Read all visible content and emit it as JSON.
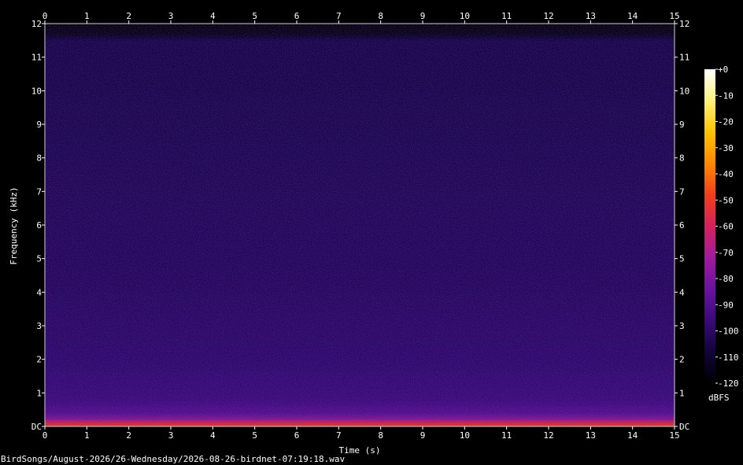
{
  "chart_data": {
    "type": "heatmap",
    "subtype": "spectrogram",
    "xlabel": "Time (s)",
    "ylabel": "Frequency (kHz)",
    "x_ticks": [
      "0",
      "1",
      "2",
      "3",
      "4",
      "5",
      "6",
      "7",
      "8",
      "9",
      "10",
      "11",
      "12",
      "13",
      "14",
      "15"
    ],
    "y_ticks": [
      "DC",
      "1",
      "2",
      "3",
      "4",
      "5",
      "6",
      "7",
      "8",
      "9",
      "10",
      "11",
      "12"
    ],
    "xlim": [
      0,
      15
    ],
    "ylim": [
      0,
      12
    ],
    "colorbar": {
      "label": "dBFS",
      "ticks": [
        "+0",
        "-10",
        "-20",
        "-30",
        "-40",
        "-50",
        "-60",
        "-70",
        "-80",
        "-90",
        "-100",
        "-110",
        "-120"
      ],
      "range": [
        -120,
        0
      ],
      "colormap": [
        "#000000",
        "#12043a",
        "#3a0a7a",
        "#6a12a0",
        "#a11a9c",
        "#d2225e",
        "#f0401a",
        "#ff8800",
        "#ffc400",
        "#fff27a",
        "#ffffff"
      ]
    },
    "energy_profile": {
      "description_free": true,
      "frequency_khz": [
        0,
        0.1,
        0.2,
        0.4,
        0.7,
        1.0,
        2.0,
        4.0,
        8.0,
        11.5,
        11.7,
        12
      ],
      "level_dbfs": [
        -48,
        -55,
        -72,
        -86,
        -92,
        -95,
        -98,
        -101,
        -104,
        -106,
        -118,
        -120
      ]
    }
  },
  "footer": {
    "filename": "BirdSongs/August-2026/26-Wednesday/2026-08-26-birdnet-07:19:18.wav"
  },
  "colors": {
    "background": "#000000",
    "frame": "#ffffff",
    "plot_base": "#1c0c5a"
  }
}
